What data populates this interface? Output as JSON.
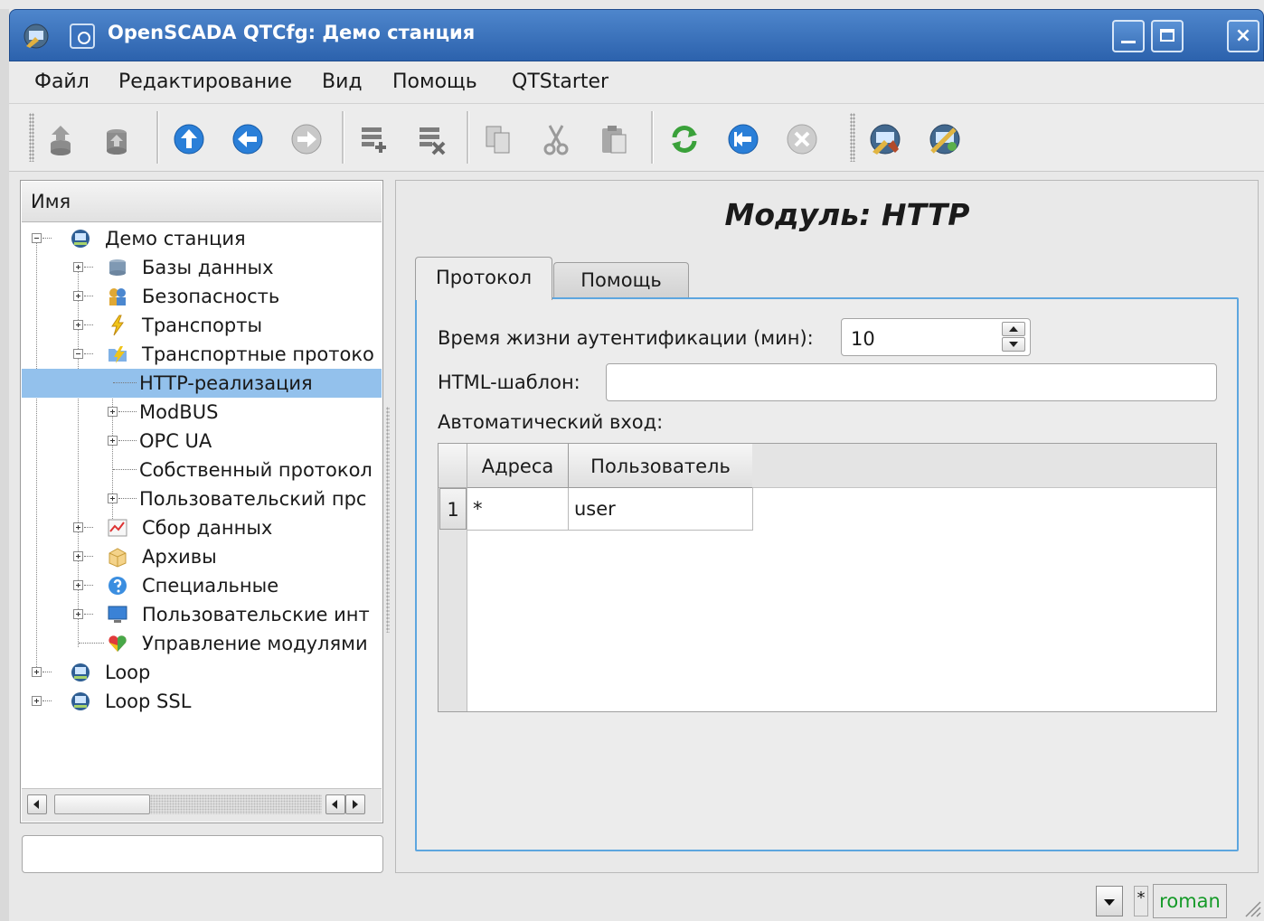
{
  "window": {
    "title": "OpenSCADA QTCfg: Демо станция",
    "close_glyph": "×"
  },
  "menu": {
    "file": "Файл",
    "edit": "Редактирование",
    "view": "Вид",
    "help": "Помощь",
    "qtstarter": "QTStarter"
  },
  "toolbar": {
    "icons": [
      "db-load-icon",
      "db-save-icon",
      "up-icon",
      "back-icon",
      "forward-icon",
      "item-add-icon",
      "item-delete-icon",
      "copy-icon",
      "cut-icon",
      "paste-icon",
      "refresh-icon",
      "start-icon",
      "stop-icon",
      "qtcfg-icon",
      "vision-icon"
    ]
  },
  "tree": {
    "header": "Имя",
    "items": [
      {
        "label": "Демо станция"
      },
      {
        "label": "Базы данных"
      },
      {
        "label": "Безопасность"
      },
      {
        "label": "Транспорты"
      },
      {
        "label": "Транспортные протоко"
      },
      {
        "label": "HTTP-реализация"
      },
      {
        "label": "ModBUS"
      },
      {
        "label": "OPC UA"
      },
      {
        "label": "Собственный протокол"
      },
      {
        "label": "Пользовательский прс"
      },
      {
        "label": "Сбор данных"
      },
      {
        "label": "Архивы"
      },
      {
        "label": "Специальные"
      },
      {
        "label": "Пользовательские инт"
      },
      {
        "label": "Управление модулями"
      },
      {
        "label": "Loop"
      },
      {
        "label": "Loop SSL"
      }
    ]
  },
  "page": {
    "title": "Модуль: HTTP",
    "tabs": [
      {
        "label": "Протокол"
      },
      {
        "label": "Помощь"
      }
    ],
    "auth_lifetime_label": "Время жизни аутентификации (мин):",
    "auth_lifetime_value": "10",
    "html_template_label": "HTML-шаблон:",
    "html_template_value": "",
    "auto_login_label": "Автоматический вход:",
    "auto_login_table": {
      "columns": [
        "Адреса",
        "Пользователь"
      ],
      "rows": [
        {
          "num": "1",
          "address": "*",
          "user": "user"
        }
      ]
    }
  },
  "statusbar": {
    "modified": "*",
    "user": "roman"
  },
  "colors": {
    "titlebar": "#2c62ad",
    "selection": "#93c1ec",
    "panel_focus": "#5da6df",
    "user": "#159a28"
  }
}
